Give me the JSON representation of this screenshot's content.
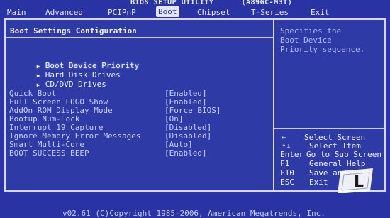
{
  "title": "BIOS SETUP UTILITY",
  "model": "(A89GC-M3T)",
  "menu": [
    "Main",
    "Advanced",
    "PCIPnP",
    "Boot",
    "Chipset",
    "T-Series",
    "Exit"
  ],
  "active_menu": "Boot",
  "section_title": "Boot Settings Configuration",
  "submenus": [
    "Boot Device Priority",
    "Hard Disk Drives",
    "CD/DVD Drives"
  ],
  "options": [
    {
      "label": "Quick Boot",
      "value": "[Enabled]"
    },
    {
      "label": "Full Screen LOGO Show",
      "value": "[Enabled]"
    },
    {
      "label": "AddOn ROM Display Mode",
      "value": "[Force BIOS]"
    },
    {
      "label": "Bootup Num-Lock",
      "value": "[On]"
    },
    {
      "label": "Interrupt 19 Capture",
      "value": "[Disabled]"
    },
    {
      "label": "Ignore Memory Error Messages",
      "value": "[Disabled]"
    },
    {
      "label": "Smart Multi-Core",
      "value": "[Auto]"
    },
    {
      "label": "BOOT SUCCESS BEEP",
      "value": "[Enabled]"
    }
  ],
  "help": {
    "lines": [
      "Specifies the",
      "Boot Device",
      "Priority sequence."
    ],
    "keys": [
      {
        "key": "←",
        "desc": "Select Screen"
      },
      {
        "key": "↑↓",
        "desc": "Select Item"
      },
      {
        "key": "Enter",
        "desc": "Go to Sub Screen"
      },
      {
        "key": "F1",
        "desc": "General Help"
      },
      {
        "key": "F10",
        "desc": "Save and Exit"
      },
      {
        "key": "ESC",
        "desc": "Exit"
      }
    ]
  },
  "footer": "v02.61 (C)Copyright 1985-2006, American Megatrends, Inc.",
  "watermark": "L"
}
